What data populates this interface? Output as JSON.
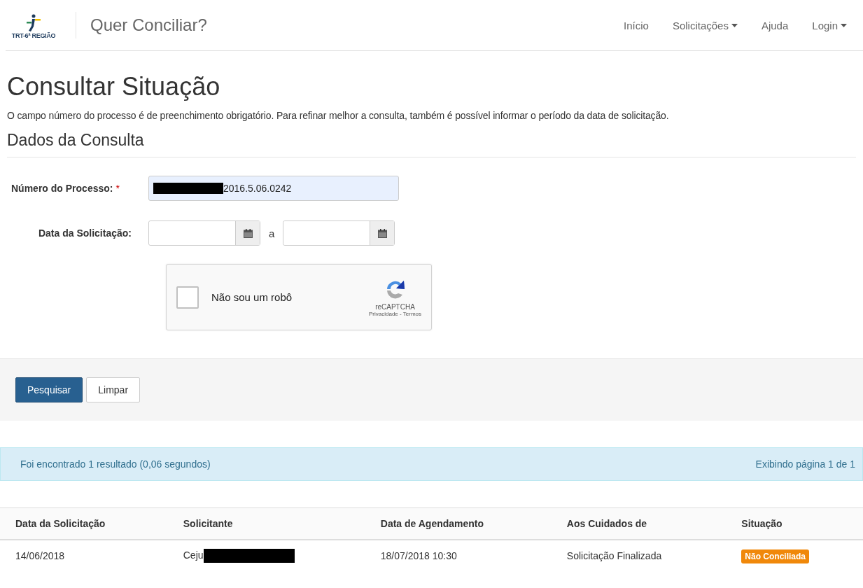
{
  "navbar": {
    "logo_text": "TRT-6ª REGIÃO",
    "brand": "Quer Conciliar?",
    "links": [
      {
        "label": "Início",
        "dropdown": false
      },
      {
        "label": "Solicitações",
        "dropdown": true
      },
      {
        "label": "Ajuda",
        "dropdown": false
      },
      {
        "label": "Login",
        "dropdown": true
      }
    ]
  },
  "page_title": "Consultar Situação",
  "intro": "O campo número do processo é de preenchimento obrigatório. Para refinar melhor a consulta, também é possível informar o período da data de solicitação.",
  "section_title": "Dados da Consulta",
  "form": {
    "process_label": "Número do Processo:",
    "required_mark": "*",
    "process_value": "2016.5.06.0242",
    "process_redacted": true,
    "date_label": "Data da Solicitação:",
    "date_separator": "a",
    "captcha": {
      "label": "Não sou um robô",
      "checked": false,
      "brand": "reCAPTCHA",
      "links": "Privacidade - Termos"
    }
  },
  "buttons": [
    {
      "label": "Pesquisar",
      "primary": true
    },
    {
      "label": "Limpar",
      "primary": false
    }
  ],
  "result_bar": {
    "message": "Foi encontrado 1 resultado (0,06 segundos)",
    "pagination": "Exibindo página 1 de 1"
  },
  "table": {
    "columns": [
      "Data da Solicitação",
      "Solicitante",
      "Data de Agendamento",
      "Aos Cuidados de",
      "Situação"
    ],
    "rows": [
      {
        "cells": [
          "14/06/2018",
          "Ceju",
          "18/07/2018 10:30",
          "Solicitação Finalizada"
        ],
        "redacted": [
          false,
          true,
          false,
          false
        ],
        "status": "Não Conciliada"
      }
    ]
  }
}
